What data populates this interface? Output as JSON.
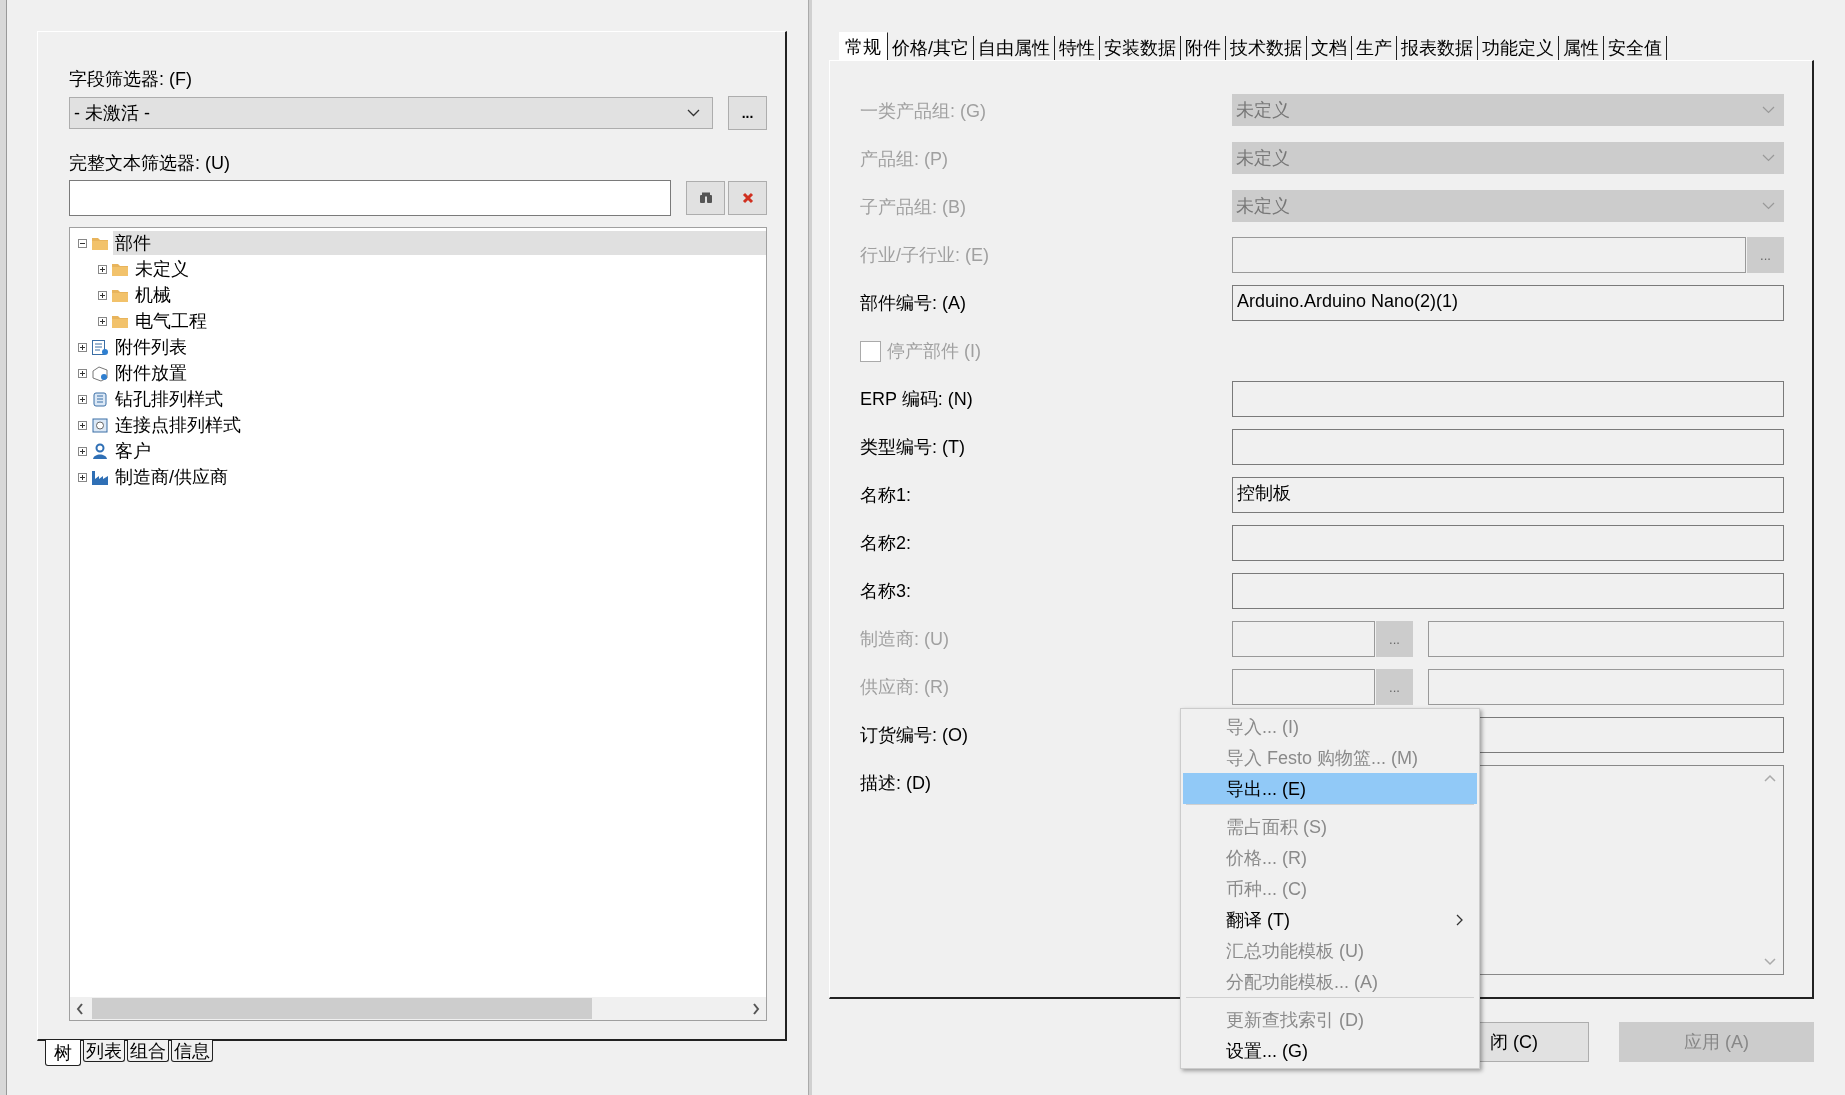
{
  "left_panel": {
    "field_filter": {
      "label": "字段筛选器: (F)",
      "value": "- 未激活 -",
      "button": "..."
    },
    "text_filter": {
      "label": "完整文本筛选器: (U)"
    },
    "tree": [
      {
        "label": "部件",
        "kind": "folder",
        "expanded": true,
        "selected": true,
        "children": [
          {
            "label": "未定义",
            "kind": "folder",
            "expanded": false,
            "selected": false
          },
          {
            "label": "机械",
            "kind": "folder",
            "expanded": false,
            "selected": false
          },
          {
            "label": "电气工程",
            "kind": "folder",
            "expanded": false,
            "selected": false
          }
        ]
      },
      {
        "label": "附件列表",
        "kind": "list",
        "expanded": false,
        "selected": false
      },
      {
        "label": "附件放置",
        "kind": "placement",
        "expanded": false,
        "selected": false
      },
      {
        "label": "钻孔排列样式",
        "kind": "drill",
        "expanded": false,
        "selected": false
      },
      {
        "label": "连接点排列样式",
        "kind": "connect",
        "expanded": false,
        "selected": false
      },
      {
        "label": "客户",
        "kind": "person",
        "expanded": false,
        "selected": false
      },
      {
        "label": "制造商/供应商",
        "kind": "factory",
        "expanded": false,
        "selected": false
      }
    ],
    "bottom_tabs": [
      {
        "label": "树",
        "selected": true
      },
      {
        "label": "列表",
        "selected": false
      },
      {
        "label": "组合",
        "selected": false
      },
      {
        "label": "信息",
        "selected": false
      }
    ]
  },
  "tabs": [
    {
      "label": "常规",
      "selected": true
    },
    {
      "label": "价格/其它",
      "selected": false
    },
    {
      "label": "自由属性",
      "selected": false
    },
    {
      "label": "特性",
      "selected": false
    },
    {
      "label": "安装数据",
      "selected": false
    },
    {
      "label": "附件",
      "selected": false
    },
    {
      "label": "技术数据",
      "selected": false
    },
    {
      "label": "文档",
      "selected": false
    },
    {
      "label": "生产",
      "selected": false
    },
    {
      "label": "报表数据",
      "selected": false
    },
    {
      "label": "功能定义",
      "selected": false
    },
    {
      "label": "属性",
      "selected": false
    },
    {
      "label": "安全值",
      "selected": false
    }
  ],
  "form": [
    {
      "kind": "dropdown",
      "label": "一类产品组: (G)",
      "value": "未定义",
      "disabled": true
    },
    {
      "kind": "dropdown",
      "label": "产品组: (P)",
      "value": "未定义",
      "disabled": true
    },
    {
      "kind": "dropdown",
      "label": "子产品组: (B)",
      "value": "未定义",
      "disabled": true
    },
    {
      "kind": "browse",
      "label": "行业/子行业: (E)",
      "button": "...",
      "disabled": true
    },
    {
      "kind": "text",
      "label": "部件编号: (A)",
      "value": "Arduino.Arduino Nano(2)(1)",
      "disabled": false
    },
    {
      "kind": "checkbox",
      "label": "停产部件 (I)",
      "checked": false,
      "disabled": true
    },
    {
      "kind": "text",
      "label": "ERP 编码: (N)",
      "disabled": false
    },
    {
      "kind": "text",
      "label": "类型编号: (T)",
      "disabled": false
    },
    {
      "kind": "text",
      "label": "名称1:",
      "value": "控制板",
      "disabled": false
    },
    {
      "kind": "text",
      "label": "名称2:",
      "disabled": false
    },
    {
      "kind": "text",
      "label": "名称3:",
      "disabled": false
    },
    {
      "kind": "split",
      "label": "制造商: (U)",
      "button": "...",
      "disabled": true
    },
    {
      "kind": "split",
      "label": "供应商: (R)",
      "button": "...",
      "disabled": true
    },
    {
      "kind": "text",
      "label": "订货编号: (O)",
      "disabled": false
    },
    {
      "kind": "textarea",
      "label": "描述: (D)",
      "disabled": false
    }
  ],
  "buttons": [
    {
      "label": "闭 (C)",
      "disabled": false
    },
    {
      "label": "应用 (A)",
      "disabled": true
    }
  ],
  "context_menu": [
    {
      "label": "导入... (I)",
      "disabled": true,
      "selected": false
    },
    {
      "label": "导入 Festo 购物篮... (M)",
      "disabled": true,
      "selected": false
    },
    {
      "label": "导出... (E)",
      "disabled": false,
      "selected": true,
      "separator_after": true
    },
    {
      "label": "需占面积 (S)",
      "disabled": true,
      "selected": false
    },
    {
      "label": "价格... (R)",
      "disabled": true,
      "selected": false
    },
    {
      "label": "币种... (C)",
      "disabled": true,
      "selected": false
    },
    {
      "label": "翻译 (T)",
      "disabled": false,
      "selected": false,
      "submenu": true
    },
    {
      "label": "汇总功能模板 (U)",
      "disabled": true,
      "selected": false
    },
    {
      "label": "分配功能模板... (A)",
      "disabled": true,
      "selected": false,
      "separator_after": true
    },
    {
      "label": "更新查找索引 (D)",
      "disabled": true,
      "selected": false
    },
    {
      "label": "设置... (G)",
      "disabled": false,
      "selected": false
    }
  ]
}
